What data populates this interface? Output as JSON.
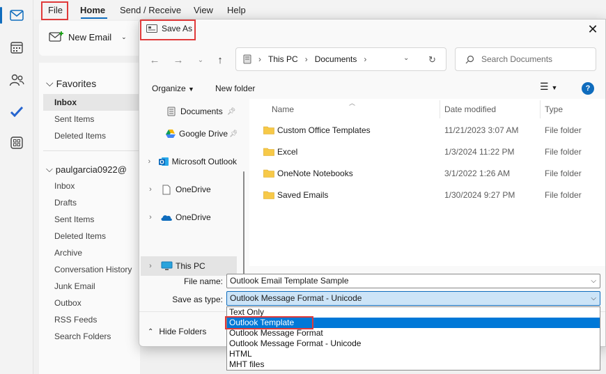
{
  "menu": {
    "file": "File",
    "home": "Home",
    "send_receive": "Send / Receive",
    "view": "View",
    "help": "Help"
  },
  "ribbon": {
    "new_email": "New Email"
  },
  "folders": {
    "favorites_header": "Favorites",
    "favorites": [
      "Inbox",
      "Sent Items",
      "Deleted Items"
    ],
    "account_header": "paulgarcia0922@",
    "account_items": [
      "Inbox",
      "Drafts",
      "Sent Items",
      "Deleted Items",
      "Archive",
      "Conversation History",
      "Junk Email",
      "Outbox",
      "RSS Feeds",
      "Search Folders"
    ]
  },
  "dialog": {
    "title": "Save As",
    "breadcrumb": [
      "This PC",
      "Documents"
    ],
    "search_placeholder": "Search Documents",
    "organize": "Organize",
    "new_folder": "New folder",
    "tree": [
      {
        "label": "Documents",
        "pinned": true
      },
      {
        "label": "Google Drive",
        "pinned": true
      },
      {
        "label": "Microsoft Outlook"
      },
      {
        "label": "OneDrive"
      },
      {
        "label": "OneDrive"
      },
      {
        "label": "This PC"
      }
    ],
    "columns": {
      "name": "Name",
      "date": "Date modified",
      "type": "Type"
    },
    "files": [
      {
        "name": "Custom Office Templates",
        "date": "11/21/2023 3:07 AM",
        "type": "File folder"
      },
      {
        "name": "Excel",
        "date": "1/3/2024 11:22 PM",
        "type": "File folder"
      },
      {
        "name": "OneNote Notebooks",
        "date": "3/1/2022 1:26 AM",
        "type": "File folder"
      },
      {
        "name": "Saved Emails",
        "date": "1/30/2024 9:27 PM",
        "type": "File folder"
      }
    ],
    "file_name_label": "File name:",
    "file_name_value": "Outlook Email Template Sample",
    "save_type_label": "Save as type:",
    "save_type_value": "Outlook Message Format - Unicode",
    "hide_folders": "Hide Folders",
    "type_options": [
      "Text Only",
      "Outlook Template",
      "Outlook Message Format",
      "Outlook Message Format - Unicode",
      "HTML",
      "MHT files"
    ]
  },
  "colors": {
    "accent": "#0f6cbd",
    "highlight": "#e03a3a",
    "option_selected": "#0078d7"
  }
}
